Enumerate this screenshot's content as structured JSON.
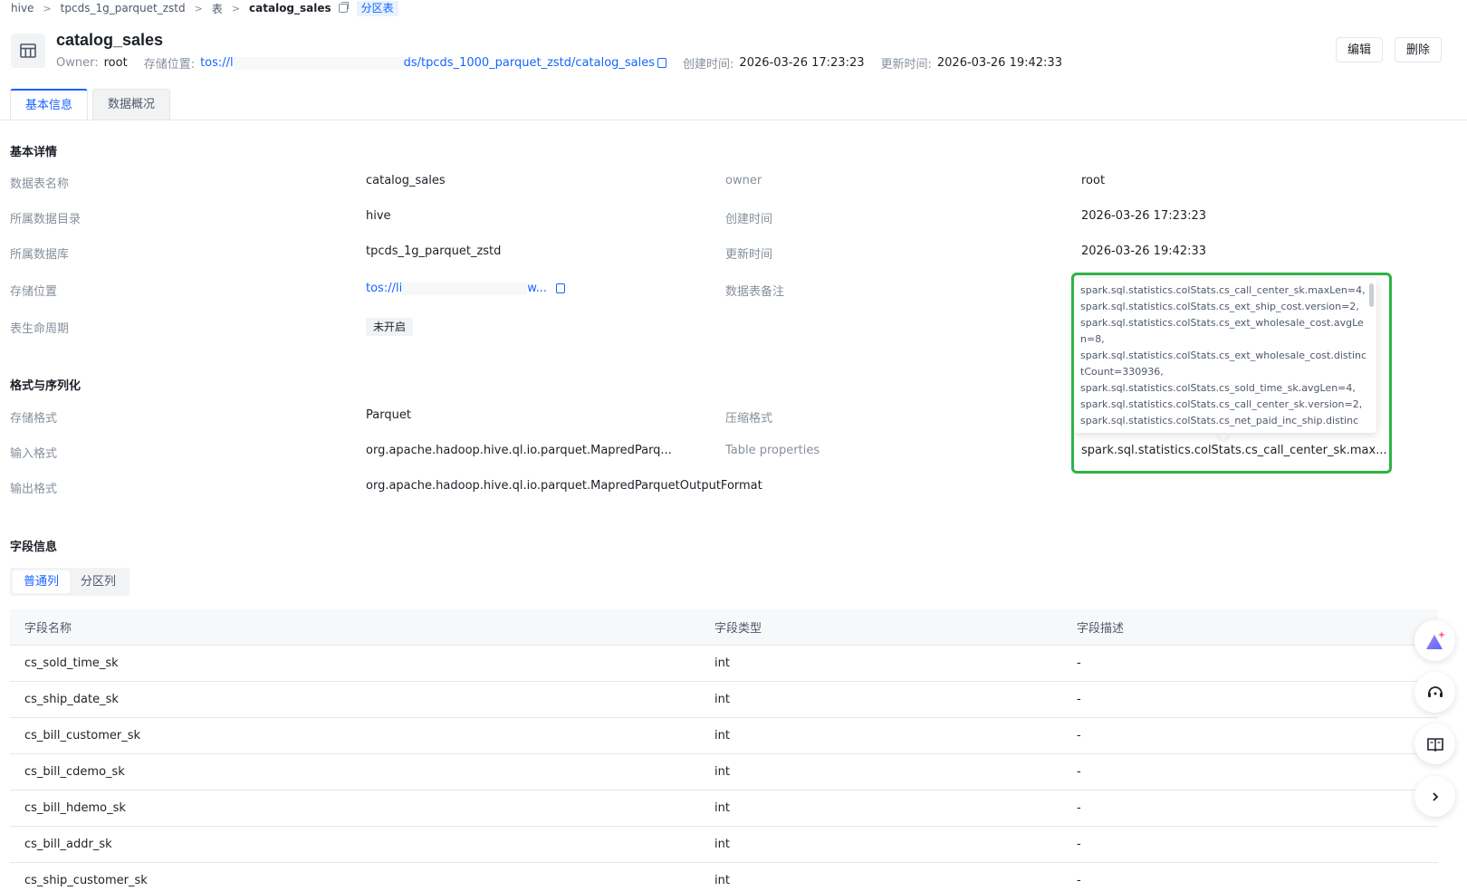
{
  "breadcrumb": {
    "items": [
      "hive",
      "tpcds_1g_parquet_zstd",
      "表"
    ],
    "separator": ">",
    "current": "catalog_sales",
    "tag": "分区表"
  },
  "header": {
    "title": "catalog_sales",
    "owner_label": "Owner:",
    "owner_value": "root",
    "storage_label": "存储位置:",
    "storage_prefix": "tos://l",
    "storage_suffix": "ds/tpcds_1000_parquet_zstd/catalog_sales",
    "created_label": "创建时间:",
    "created_value": "2026-03-26 17:23:23",
    "updated_label": "更新时间:",
    "updated_value": "2026-03-26 19:42:33",
    "edit_label": "编辑",
    "delete_label": "删除"
  },
  "tabs": [
    "基本信息",
    "数据概况"
  ],
  "basic": {
    "section_title": "基本详情",
    "table_name_label": "数据表名称",
    "table_name_value": "catalog_sales",
    "catalog_label": "所属数据目录",
    "catalog_value": "hive",
    "database_label": "所属数据库",
    "database_value": "tpcds_1g_parquet_zstd",
    "storage_label": "存储位置",
    "storage_value_prefix": "tos://li",
    "storage_value_suffix": "w...",
    "lifecycle_label": "表生命周期",
    "lifecycle_value": "未开启",
    "owner_label": "owner",
    "owner_value": "root",
    "created_label": "创建时间",
    "created_value": "2026-03-26 17:23:23",
    "updated_label": "更新时间",
    "updated_value": "2026-03-26 19:42:33",
    "comment_label": "数据表备注"
  },
  "format": {
    "section_title": "格式与序列化",
    "storage_format_label": "存储格式",
    "storage_format_value": "Parquet",
    "input_format_label": "输入格式",
    "input_format_value": "org.apache.hadoop.hive.ql.io.parquet.MapredParq...",
    "output_format_label": "输出格式",
    "output_format_value": "org.apache.hadoop.hive.ql.io.parquet.MapredParquetOutputFormat",
    "compression_label": "压缩格式",
    "table_properties_label": "Table properties",
    "table_properties_value": "spark.sql.statistics.colStats.cs_call_center_sk.max..."
  },
  "tooltip": {
    "lines": [
      "spark.sql.statistics.colStats.cs_call_center_sk.maxLen=4,",
      "spark.sql.statistics.colStats.cs_ext_ship_cost.version=2,",
      "spark.sql.statistics.colStats.cs_ext_wholesale_cost.avgLen=8,",
      "spark.sql.statistics.colStats.cs_ext_wholesale_cost.distinctCount=330936,",
      "spark.sql.statistics.colStats.cs_sold_time_sk.avgLen=4,",
      "spark.sql.statistics.colStats.cs_call_center_sk.version=2,",
      "spark.sql.statistics.colStats.cs_net_paid_inc_ship.distinc"
    ]
  },
  "fields": {
    "section_title": "字段信息",
    "subtabs": [
      "普通列",
      "分区列"
    ],
    "columns": [
      "字段名称",
      "字段类型",
      "字段描述"
    ],
    "rows": [
      [
        "cs_sold_time_sk",
        "int",
        "-"
      ],
      [
        "cs_ship_date_sk",
        "int",
        "-"
      ],
      [
        "cs_bill_customer_sk",
        "int",
        "-"
      ],
      [
        "cs_bill_cdemo_sk",
        "int",
        "-"
      ],
      [
        "cs_bill_hdemo_sk",
        "int",
        "-"
      ],
      [
        "cs_bill_addr_sk",
        "int",
        "-"
      ],
      [
        "cs_ship_customer_sk",
        "int",
        "-"
      ]
    ]
  },
  "floating": {
    "icons": [
      "ai-assistant-icon",
      "headset-icon",
      "book-icon",
      "chevron-right-icon"
    ]
  },
  "colors": {
    "primary": "#1664ff",
    "highlight": "#2fb344"
  }
}
